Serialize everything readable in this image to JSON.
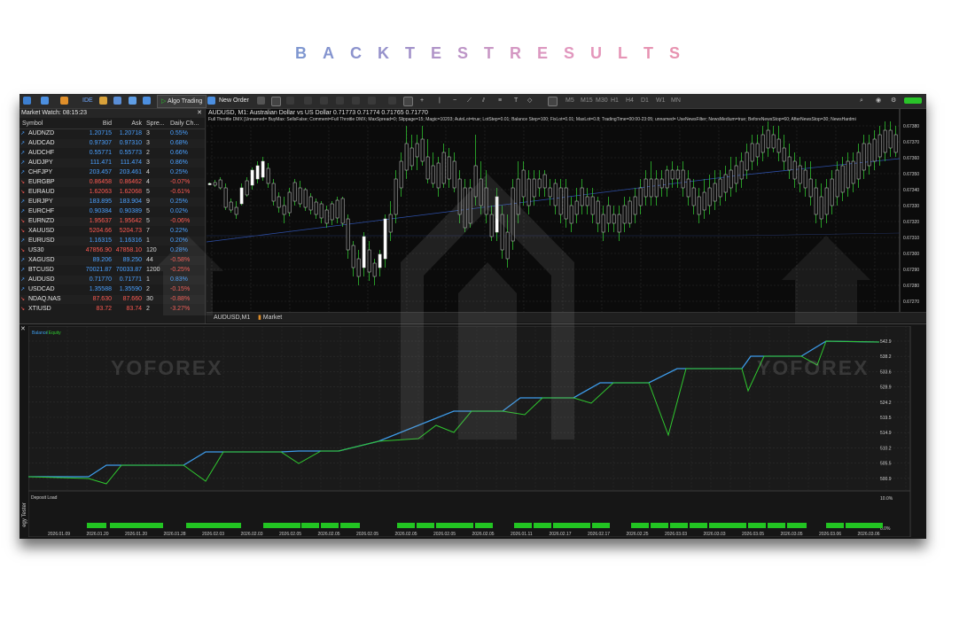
{
  "heading": {
    "letters": [
      {
        "char": "B",
        "color": "#7f97d0"
      },
      {
        "char": "A",
        "color": "#8494cf"
      },
      {
        "char": "C",
        "color": "#8c93cd"
      },
      {
        "char": "K",
        "color": "#9692cb"
      },
      {
        "char": "T",
        "color": "#a292ca"
      },
      {
        "char": "E",
        "color": "#b094c8"
      },
      {
        "char": "S",
        "color": "#bd95c7"
      },
      {
        "char": "T",
        "color": "#c897c5"
      },
      {
        "char": "R",
        "color": "#d498c3"
      },
      {
        "char": "E",
        "color": "#dc98c0"
      },
      {
        "char": "S",
        "color": "#e197be"
      },
      {
        "char": "U",
        "color": "#e496ba"
      },
      {
        "char": "L",
        "color": "#e695b6"
      },
      {
        "char": "T",
        "color": "#e794b3"
      },
      {
        "char": "S",
        "color": "#e793b0"
      }
    ]
  },
  "toolbar": {
    "ide_label": "IDE",
    "algo_trading_label": "Algo Trading",
    "new_order_label": "New Order",
    "timeframes": [
      "M5",
      "M15",
      "M30",
      "H1",
      "H4",
      "D1",
      "W1",
      "MN"
    ]
  },
  "market_watch": {
    "title": "Market Watch: 08:15:23",
    "columns": [
      "Symbol",
      "Bid",
      "Ask",
      "Spre...",
      "Daily Ch..."
    ],
    "rows": [
      {
        "symbol": "AUDNZD",
        "bid": "1.20715",
        "ask": "1.20718",
        "spread": "3",
        "change": "0.55%",
        "dir": "up"
      },
      {
        "symbol": "AUDCAD",
        "bid": "0.97307",
        "ask": "0.97310",
        "spread": "3",
        "change": "0.68%",
        "dir": "up"
      },
      {
        "symbol": "AUDCHF",
        "bid": "0.55771",
        "ask": "0.55773",
        "spread": "2",
        "change": "0.66%",
        "dir": "up"
      },
      {
        "symbol": "AUDJPY",
        "bid": "111.471",
        "ask": "111.474",
        "spread": "3",
        "change": "0.86%",
        "dir": "up"
      },
      {
        "symbol": "CHFJPY",
        "bid": "203.457",
        "ask": "203.461",
        "spread": "4",
        "change": "0.25%",
        "dir": "up"
      },
      {
        "symbol": "EURGBP",
        "bid": "0.86458",
        "ask": "0.86462",
        "spread": "4",
        "change": "-0.07%",
        "dir": "down"
      },
      {
        "symbol": "EURAUD",
        "bid": "1.62063",
        "ask": "1.62068",
        "spread": "5",
        "change": "-0.61%",
        "dir": "down"
      },
      {
        "symbol": "EURJPY",
        "bid": "183.895",
        "ask": "183.904",
        "spread": "9",
        "change": "0.25%",
        "dir": "up"
      },
      {
        "symbol": "EURCHF",
        "bid": "0.90384",
        "ask": "0.90389",
        "spread": "5",
        "change": "0.02%",
        "dir": "up"
      },
      {
        "symbol": "EURNZD",
        "bid": "1.95637",
        "ask": "1.95642",
        "spread": "5",
        "change": "-0.06%",
        "dir": "down"
      },
      {
        "symbol": "XAUUSD",
        "bid": "5204.66",
        "ask": "5204.73",
        "spread": "7",
        "change": "0.22%",
        "dir": "down"
      },
      {
        "symbol": "EURUSD",
        "bid": "1.16315",
        "ask": "1.16316",
        "spread": "1",
        "change": "0.20%",
        "dir": "up"
      },
      {
        "symbol": "US30",
        "bid": "47856.90",
        "ask": "47858.10",
        "spread": "120",
        "change": "0.28%",
        "dir": "down"
      },
      {
        "symbol": "XAGUSD",
        "bid": "89.206",
        "ask": "89.250",
        "spread": "44",
        "change": "-0.58%",
        "dir": "up"
      },
      {
        "symbol": "BTCUSD",
        "bid": "70021.87",
        "ask": "70033.87",
        "spread": "1200",
        "change": "-0.25%",
        "dir": "up"
      },
      {
        "symbol": "AUDUSD",
        "bid": "0.71770",
        "ask": "0.71771",
        "spread": "1",
        "change": "0.83%",
        "dir": "up"
      },
      {
        "symbol": "USDCAD",
        "bid": "1.35588",
        "ask": "1.35590",
        "spread": "2",
        "change": "-0.15%",
        "dir": "up"
      },
      {
        "symbol": "NDAQ.NAS",
        "bid": "87.630",
        "ask": "87.660",
        "spread": "30",
        "change": "-0.88%",
        "dir": "down"
      },
      {
        "symbol": "XTIUSD",
        "bid": "83.72",
        "ask": "83.74",
        "spread": "2",
        "change": "-3.27%",
        "dir": "down"
      }
    ],
    "tabs": [
      "Symbols",
      "Details",
      "Trading",
      "Ticks"
    ]
  },
  "chart": {
    "info": "AUDUSD, M1:  Australian Dollar vs US Dollar  0.71773 0.71774 0.71765 0.71770",
    "params": "Full Throttle DMX [Unnamed=  BuyMax: SellsFalse; Comment=Full Throttle DMX; MaxSpread=0; Slippage=15; Magic=10203; AutoLot=true; LotStep=0.01; Balance Step=100; FixLot=0.01; MaxLot=0.8; TradingTime=00:00-23:05; unnamed=  UseNewsFilter; NewsMedium=true; BeforeNewsStop=60; AfterNewsStop=30; NewsHardmi",
    "price_labels": [
      "0.67380",
      "0.67370",
      "0.67360",
      "0.67350",
      "0.67340",
      "0.67330",
      "0.67320",
      "0.67310",
      "0.67300",
      "0.67290",
      "0.67280",
      "0.67270"
    ],
    "tabs": [
      "AUDUSD,M1",
      "Market"
    ]
  },
  "tester": {
    "legend_balance": "Balance",
    "legend_equity": "Equity",
    "vertical_label": "egy Tester",
    "deposit_label": "Deposit Load",
    "balance_labels": [
      "542.9",
      "538.2",
      "533.6",
      "528.9",
      "524.2",
      "519.5",
      "514.9",
      "510.2",
      "505.5",
      "500.9",
      "496.2"
    ],
    "load_labels": [
      "10.0%",
      "0.0%"
    ],
    "dates": [
      "2026.01.09",
      "2026.01.20",
      "2026.01.20",
      "2026.01.28",
      "2026.02.03",
      "2026.02.03",
      "2026.02.05",
      "2026.02.05",
      "2026.02.05",
      "2026.02.05",
      "2026.02.05",
      "2026.02.05",
      "2026.01.11",
      "2026.02.17",
      "2026.02.17",
      "2026.02.25",
      "2026.03.03",
      "2026.03.03",
      "2026.03.05",
      "2026.03.05",
      "2026.03.06",
      "2026.03.06"
    ],
    "colors": {
      "balance": "#3d9be9",
      "equity": "#2fc72f",
      "load": "#22c422"
    }
  },
  "watermark": {
    "text": "YOFOREX"
  }
}
